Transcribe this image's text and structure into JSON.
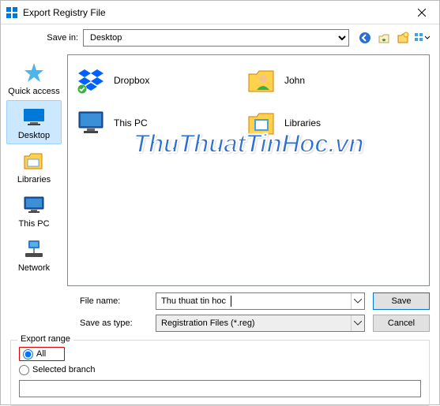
{
  "window": {
    "title": "Export Registry File"
  },
  "savein": {
    "label": "Save in:",
    "value": "Desktop"
  },
  "toolbar": {
    "back": "back-icon",
    "up": "up-icon",
    "newfolder": "new-folder-icon",
    "views": "views-icon"
  },
  "places": [
    {
      "id": "quick-access",
      "label": "Quick access",
      "selected": false
    },
    {
      "id": "desktop",
      "label": "Desktop",
      "selected": true
    },
    {
      "id": "libraries",
      "label": "Libraries",
      "selected": false
    },
    {
      "id": "this-pc",
      "label": "This PC",
      "selected": false
    },
    {
      "id": "network",
      "label": "Network",
      "selected": false
    }
  ],
  "files": [
    {
      "label": "Dropbox",
      "icon": "dropbox"
    },
    {
      "label": "John",
      "icon": "user"
    },
    {
      "label": "This PC",
      "icon": "pc"
    },
    {
      "label": "Libraries",
      "icon": "libraries"
    }
  ],
  "watermark_text": "ThuThuatTinHoc.vn",
  "filename": {
    "label": "File name:",
    "value": "Thu thuat tin hoc"
  },
  "savetype": {
    "label": "Save as type:",
    "value": "Registration Files (*.reg)"
  },
  "buttons": {
    "save": "Save",
    "cancel": "Cancel"
  },
  "export_range": {
    "legend": "Export range",
    "all": "All",
    "selected_branch": "Selected branch",
    "branch_value": "",
    "selected": "all"
  }
}
